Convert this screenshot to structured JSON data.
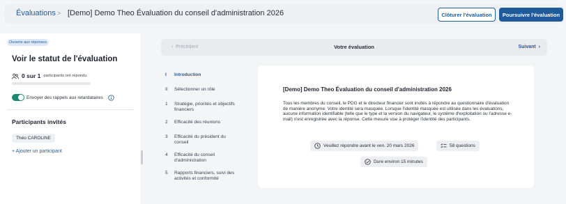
{
  "header": {
    "breadcrumb_link": "Évaluations",
    "breadcrumb_separator": ">",
    "title": "[Demo] Demo Theo Évaluation du conseil d'administration 2026",
    "close_button": "Clôturer l'évaluation",
    "continue_button": "Poursuivre l'évaluation"
  },
  "left": {
    "badge": "Ouverte aux réponses",
    "status_title": "Voir le statut de l'évaluation",
    "count_strong": "0 sur 1",
    "count_label": "participants ont répondu",
    "progress_fraction": 0,
    "reminder_label": "Envoyer des rappels aux retardataires",
    "reminder_on": true,
    "invited_title": "Participants invités",
    "participants": [
      "Théo CAROLINE"
    ],
    "add_participant": "+ Ajouter un participant"
  },
  "pager": {
    "prev": "Précédent",
    "current": "Votre évaluation",
    "next": "Suivant"
  },
  "toc": [
    {
      "num": "I",
      "label": "Introduction",
      "active": true
    },
    {
      "num": "II",
      "label": "Sélectionner un rôle"
    },
    {
      "num": "1",
      "label": "Stratégie, priorités et objectifs financiers"
    },
    {
      "num": "2",
      "label": "Efficacité des réunions"
    },
    {
      "num": "3",
      "label": "Efficacité du président du conseil"
    },
    {
      "num": "4",
      "label": "Efficacité du conseil d'administration"
    },
    {
      "num": "5",
      "label": "Rapports financiers, suivi des activités et conformité"
    }
  ],
  "card": {
    "title": "[Demo] Demo Theo Évaluation du conseil d'administration 2026",
    "text": "Tous les membres du conseil, le PDG et le directeur financier sont invités à répondre au questionnaire d'évaluation de manière anonyme. Votre identité sera masquée. Lorsque l'identité masquée est utilisée dans les évaluations, aucune information identifiable (telle que le type et la version du navigateur, le système d'exploitation ou l'adresse e-mail) n'est enregistrée avec la réponse. Cette mesure vise à protéger l'identité des participants.",
    "deadline": "Veuillez répondre avant le ven. 20 mars 2026",
    "questions": "58 questions",
    "duration": "Dure environ 15 minutes"
  },
  "colors": {
    "accent": "#1f5b9a",
    "toggle": "#1c8a6f"
  }
}
